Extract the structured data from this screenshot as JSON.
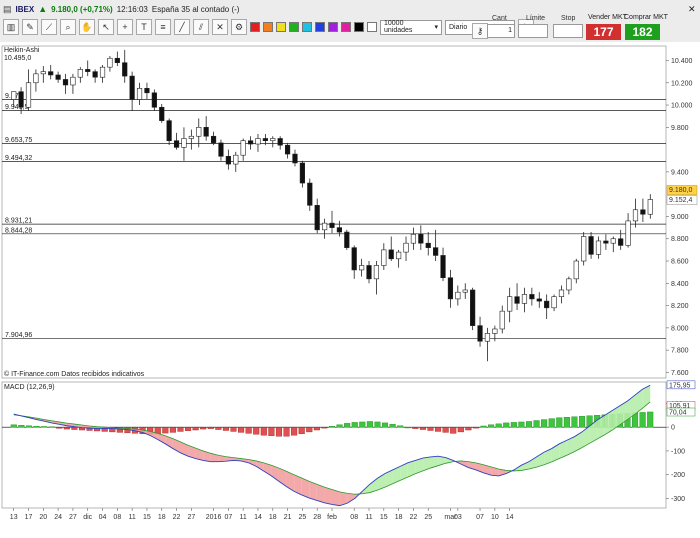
{
  "toolbar": {
    "symbol": "IBEX",
    "price_change": "9.180,0 (+0,71%)",
    "time": "12:16:03",
    "description": "España 35 al contado (-)",
    "units_select": "10000 unidades",
    "period_select": "Diario",
    "cant_label": "Cant",
    "cant_value": "1",
    "limite_label": "Límite",
    "stop_label": "Stop",
    "sell_label": "Vender MKT",
    "sell_value": "177",
    "buy_label": "Comprar MKT",
    "buy_value": "182",
    "sell_color": "#d03030",
    "buy_color": "#1ea01e",
    "icons": [
      "chart-type-icon",
      "pencil-icon",
      "ruler-icon",
      "zoom-icon",
      "hand-icon",
      "cursor-icon"
    ]
  },
  "chart_data": [
    {
      "type": "candlestick",
      "title": "Heikin-Ashi",
      "top_value_label": "10.495,0",
      "current_price_label": "9.180,0",
      "current_price_label2": "9.152,4",
      "footer": "© IT-Finance.com  Datos recibidos indicativos",
      "ylim": [
        7550,
        10530
      ],
      "yticks": [
        {
          "v": 10400,
          "t": "10.400"
        },
        {
          "v": 10200,
          "t": "10.200"
        },
        {
          "v": 10000,
          "t": "10.000"
        },
        {
          "v": 9800,
          "t": "9.800"
        },
        {
          "v": 9400,
          "t": "9.400"
        },
        {
          "v": 9000,
          "t": "9.000"
        },
        {
          "v": 8800,
          "t": "8.800"
        },
        {
          "v": 8600,
          "t": "8.600"
        },
        {
          "v": 8400,
          "t": "8.400"
        },
        {
          "v": 8200,
          "t": "8.200"
        },
        {
          "v": 8000,
          "t": "8.000"
        },
        {
          "v": 7800,
          "t": "7.800"
        },
        {
          "v": 7600,
          "t": "7.600"
        }
      ],
      "hlines": [
        {
          "v": 10050,
          "label": "9.77"
        },
        {
          "v": 9950,
          "label": "9.941,5"
        },
        {
          "v": 9653.75,
          "label": "9.653,75"
        },
        {
          "v": 9494.32,
          "label": "9.494,32"
        },
        {
          "v": 8931.21,
          "label": "8.931,21"
        },
        {
          "v": 8844.28,
          "label": "8.844,28"
        },
        {
          "v": 7904.96,
          "label": "7.904,96"
        }
      ],
      "candles": [
        {
          "o": 10050,
          "h": 10120,
          "l": 9980,
          "c": 10120
        },
        {
          "o": 10120,
          "h": 10160,
          "l": 9920,
          "c": 9980
        },
        {
          "o": 9980,
          "h": 10320,
          "l": 9950,
          "c": 10200
        },
        {
          "o": 10200,
          "h": 10320,
          "l": 10120,
          "c": 10280
        },
        {
          "o": 10280,
          "h": 10350,
          "l": 10200,
          "c": 10300
        },
        {
          "o": 10300,
          "h": 10360,
          "l": 10230,
          "c": 10270
        },
        {
          "o": 10270,
          "h": 10300,
          "l": 10200,
          "c": 10230
        },
        {
          "o": 10230,
          "h": 10280,
          "l": 10100,
          "c": 10180
        },
        {
          "o": 10180,
          "h": 10280,
          "l": 10100,
          "c": 10250
        },
        {
          "o": 10250,
          "h": 10340,
          "l": 10200,
          "c": 10320
        },
        {
          "o": 10320,
          "h": 10400,
          "l": 10260,
          "c": 10300
        },
        {
          "o": 10300,
          "h": 10320,
          "l": 10200,
          "c": 10250
        },
        {
          "o": 10250,
          "h": 10360,
          "l": 10200,
          "c": 10340
        },
        {
          "o": 10340,
          "h": 10440,
          "l": 10300,
          "c": 10420
        },
        {
          "o": 10420,
          "h": 10480,
          "l": 10350,
          "c": 10380
        },
        {
          "o": 10380,
          "h": 10495,
          "l": 10200,
          "c": 10260
        },
        {
          "o": 10260,
          "h": 10300,
          "l": 9950,
          "c": 10050
        },
        {
          "o": 10050,
          "h": 10200,
          "l": 10000,
          "c": 10150
        },
        {
          "o": 10150,
          "h": 10200,
          "l": 10050,
          "c": 10110
        },
        {
          "o": 10110,
          "h": 10140,
          "l": 9950,
          "c": 9980
        },
        {
          "o": 9980,
          "h": 10010,
          "l": 9840,
          "c": 9860
        },
        {
          "o": 9860,
          "h": 9880,
          "l": 9640,
          "c": 9680
        },
        {
          "o": 9680,
          "h": 9750,
          "l": 9600,
          "c": 9620
        },
        {
          "o": 9620,
          "h": 9800,
          "l": 9500,
          "c": 9700
        },
        {
          "o": 9700,
          "h": 9780,
          "l": 9600,
          "c": 9720
        },
        {
          "o": 9720,
          "h": 9880,
          "l": 9620,
          "c": 9800
        },
        {
          "o": 9800,
          "h": 9900,
          "l": 9680,
          "c": 9720
        },
        {
          "o": 9720,
          "h": 9760,
          "l": 9640,
          "c": 9660
        },
        {
          "o": 9660,
          "h": 9690,
          "l": 9500,
          "c": 9540
        },
        {
          "o": 9540,
          "h": 9600,
          "l": 9420,
          "c": 9470
        },
        {
          "o": 9470,
          "h": 9580,
          "l": 9400,
          "c": 9550
        },
        {
          "o": 9550,
          "h": 9700,
          "l": 9500,
          "c": 9680
        },
        {
          "o": 9680,
          "h": 9720,
          "l": 9600,
          "c": 9650
        },
        {
          "o": 9650,
          "h": 9740,
          "l": 9580,
          "c": 9700
        },
        {
          "o": 9700,
          "h": 9740,
          "l": 9640,
          "c": 9680
        },
        {
          "o": 9680,
          "h": 9720,
          "l": 9620,
          "c": 9700
        },
        {
          "o": 9700,
          "h": 9720,
          "l": 9600,
          "c": 9640
        },
        {
          "o": 9640,
          "h": 9660,
          "l": 9520,
          "c": 9560
        },
        {
          "o": 9560,
          "h": 9600,
          "l": 9450,
          "c": 9480
        },
        {
          "o": 9480,
          "h": 9500,
          "l": 9260,
          "c": 9300
        },
        {
          "o": 9300,
          "h": 9340,
          "l": 9050,
          "c": 9100
        },
        {
          "o": 9100,
          "h": 9160,
          "l": 8850,
          "c": 8880
        },
        {
          "o": 8880,
          "h": 8980,
          "l": 8800,
          "c": 8940
        },
        {
          "o": 8940,
          "h": 9050,
          "l": 8850,
          "c": 8900
        },
        {
          "o": 8900,
          "h": 8960,
          "l": 8820,
          "c": 8860
        },
        {
          "o": 8860,
          "h": 8880,
          "l": 8700,
          "c": 8720
        },
        {
          "o": 8720,
          "h": 8740,
          "l": 8440,
          "c": 8520
        },
        {
          "o": 8520,
          "h": 8620,
          "l": 8460,
          "c": 8560
        },
        {
          "o": 8560,
          "h": 8600,
          "l": 8400,
          "c": 8440
        },
        {
          "o": 8440,
          "h": 8600,
          "l": 8300,
          "c": 8560
        },
        {
          "o": 8560,
          "h": 8760,
          "l": 8520,
          "c": 8700
        },
        {
          "o": 8700,
          "h": 8820,
          "l": 8600,
          "c": 8620
        },
        {
          "o": 8620,
          "h": 8700,
          "l": 8540,
          "c": 8680
        },
        {
          "o": 8680,
          "h": 8820,
          "l": 8600,
          "c": 8760
        },
        {
          "o": 8760,
          "h": 8900,
          "l": 8700,
          "c": 8840
        },
        {
          "o": 8840,
          "h": 8920,
          "l": 8700,
          "c": 8760
        },
        {
          "o": 8760,
          "h": 8860,
          "l": 8650,
          "c": 8720
        },
        {
          "o": 8720,
          "h": 8880,
          "l": 8600,
          "c": 8650
        },
        {
          "o": 8650,
          "h": 8720,
          "l": 8420,
          "c": 8450
        },
        {
          "o": 8450,
          "h": 8520,
          "l": 8180,
          "c": 8260
        },
        {
          "o": 8260,
          "h": 8380,
          "l": 8200,
          "c": 8320
        },
        {
          "o": 8320,
          "h": 8400,
          "l": 8260,
          "c": 8340
        },
        {
          "o": 8340,
          "h": 8360,
          "l": 7980,
          "c": 8020
        },
        {
          "o": 8020,
          "h": 8100,
          "l": 7830,
          "c": 7880
        },
        {
          "o": 7880,
          "h": 8000,
          "l": 7700,
          "c": 7950
        },
        {
          "o": 7950,
          "h": 8020,
          "l": 7880,
          "c": 7990
        },
        {
          "o": 7990,
          "h": 8200,
          "l": 7950,
          "c": 8150
        },
        {
          "o": 8150,
          "h": 8360,
          "l": 8050,
          "c": 8280
        },
        {
          "o": 8280,
          "h": 8400,
          "l": 8160,
          "c": 8220
        },
        {
          "o": 8220,
          "h": 8360,
          "l": 8140,
          "c": 8300
        },
        {
          "o": 8300,
          "h": 8360,
          "l": 8200,
          "c": 8260
        },
        {
          "o": 8260,
          "h": 8320,
          "l": 8180,
          "c": 8240
        },
        {
          "o": 8240,
          "h": 8300,
          "l": 8080,
          "c": 8180
        },
        {
          "o": 8180,
          "h": 8300,
          "l": 8150,
          "c": 8280
        },
        {
          "o": 8280,
          "h": 8380,
          "l": 8220,
          "c": 8340
        },
        {
          "o": 8340,
          "h": 8460,
          "l": 8300,
          "c": 8440
        },
        {
          "o": 8440,
          "h": 8620,
          "l": 8400,
          "c": 8600
        },
        {
          "o": 8600,
          "h": 8860,
          "l": 8560,
          "c": 8820
        },
        {
          "o": 8820,
          "h": 8860,
          "l": 8620,
          "c": 8660
        },
        {
          "o": 8660,
          "h": 8820,
          "l": 8620,
          "c": 8780
        },
        {
          "o": 8780,
          "h": 8840,
          "l": 8700,
          "c": 8760
        },
        {
          "o": 8760,
          "h": 8820,
          "l": 8680,
          "c": 8800
        },
        {
          "o": 8800,
          "h": 8880,
          "l": 8700,
          "c": 8740
        },
        {
          "o": 8740,
          "h": 9030,
          "l": 8720,
          "c": 8960
        },
        {
          "o": 8960,
          "h": 9160,
          "l": 8900,
          "c": 9060
        },
        {
          "o": 9060,
          "h": 9160,
          "l": 8950,
          "c": 9020
        },
        {
          "o": 9020,
          "h": 9200,
          "l": 8980,
          "c": 9152
        }
      ],
      "xticks": [
        {
          "i": 0,
          "t": "13"
        },
        {
          "i": 2,
          "t": "17"
        },
        {
          "i": 4,
          "t": "20"
        },
        {
          "i": 6,
          "t": "24"
        },
        {
          "i": 8,
          "t": "27"
        },
        {
          "i": 10,
          "t": "dic"
        },
        {
          "i": 12,
          "t": "04"
        },
        {
          "i": 14,
          "t": "08"
        },
        {
          "i": 16,
          "t": "11"
        },
        {
          "i": 18,
          "t": "15"
        },
        {
          "i": 20,
          "t": "18"
        },
        {
          "i": 22,
          "t": "22"
        },
        {
          "i": 24,
          "t": "27"
        },
        {
          "i": 27,
          "t": "2016"
        },
        {
          "i": 29,
          "t": "07"
        },
        {
          "i": 31,
          "t": "11"
        },
        {
          "i": 33,
          "t": "14"
        },
        {
          "i": 35,
          "t": "18"
        },
        {
          "i": 37,
          "t": "21"
        },
        {
          "i": 39,
          "t": "25"
        },
        {
          "i": 41,
          "t": "28"
        },
        {
          "i": 43,
          "t": "feb"
        },
        {
          "i": 46,
          "t": "08"
        },
        {
          "i": 48,
          "t": "11"
        },
        {
          "i": 50,
          "t": "15"
        },
        {
          "i": 52,
          "t": "18"
        },
        {
          "i": 54,
          "t": "22"
        },
        {
          "i": 56,
          "t": "25"
        },
        {
          "i": 59,
          "t": "mar"
        },
        {
          "i": 60,
          "t": "03"
        },
        {
          "i": 63,
          "t": "07"
        },
        {
          "i": 65,
          "t": "10"
        },
        {
          "i": 67,
          "t": "14"
        }
      ]
    },
    {
      "type": "macd",
      "title": "MACD (12,26,9)",
      "ylim": [
        -340,
        190
      ],
      "yticks": [
        {
          "v": 100,
          "t": "100"
        },
        {
          "v": 0,
          "t": "0"
        },
        {
          "v": -100,
          "t": "-100"
        },
        {
          "v": -200,
          "t": "-200"
        },
        {
          "v": -300,
          "t": "-300"
        }
      ],
      "value_labels": [
        {
          "v": 175.95,
          "t": "175,95"
        },
        {
          "v": 105.91,
          "t": "105,91"
        },
        {
          "v": 70.04,
          "t": "70,04"
        }
      ],
      "macd": [
        55,
        47,
        40,
        32,
        25,
        18,
        12,
        6,
        2,
        -2,
        -4,
        -6,
        -5,
        -6,
        -8,
        -10,
        -15,
        -22,
        -35,
        -52,
        -70,
        -90,
        -108,
        -122,
        -132,
        -140,
        -145,
        -145,
        -143,
        -140,
        -142,
        -150,
        -165,
        -185,
        -205,
        -228,
        -250,
        -270,
        -285,
        -298,
        -308,
        -318,
        -325,
        -330,
        -320,
        -300,
        -270,
        -240,
        -215,
        -195,
        -180,
        -165,
        -150,
        -140,
        -130,
        -125,
        -122,
        -128,
        -140,
        -155,
        -170,
        -180,
        -192,
        -202,
        -205,
        -195,
        -180,
        -160,
        -145,
        -125,
        -105,
        -90,
        -70,
        -55,
        -40,
        -20,
        5,
        30,
        50,
        70,
        90,
        110,
        135,
        160,
        176
      ],
      "signal": [
        52,
        48,
        43,
        38,
        32,
        27,
        22,
        17,
        13,
        9,
        5,
        2,
        0,
        -2,
        -4,
        -6,
        -8,
        -12,
        -18,
        -26,
        -36,
        -48,
        -62,
        -76,
        -88,
        -100,
        -110,
        -118,
        -124,
        -128,
        -132,
        -136,
        -142,
        -150,
        -160,
        -172,
        -186,
        -200,
        -214,
        -228,
        -240,
        -252,
        -262,
        -272,
        -278,
        -282,
        -280,
        -275,
        -265,
        -252,
        -238,
        -224,
        -210,
        -196,
        -184,
        -172,
        -162,
        -152,
        -145,
        -142,
        -145,
        -150,
        -158,
        -167,
        -176,
        -182,
        -184,
        -182,
        -176,
        -168,
        -158,
        -146,
        -132,
        -118,
        -103,
        -86,
        -68,
        -50,
        -32,
        -12,
        10,
        32,
        55,
        80,
        106
      ],
      "histogram": [
        10,
        8,
        6,
        4,
        3,
        2,
        -5,
        -8,
        -10,
        -12,
        -14,
        -16,
        -18,
        -20,
        -22,
        -24,
        -26,
        -28,
        -30,
        -28,
        -25,
        -22,
        -18,
        -15,
        -12,
        -8,
        -6,
        -10,
        -14,
        -18,
        -22,
        -26,
        -30,
        -34,
        -36,
        -38,
        -38,
        -34,
        -28,
        -20,
        -12,
        -4,
        4,
        10,
        16,
        20,
        22,
        24,
        22,
        18,
        12,
        6,
        0,
        -6,
        -10,
        -14,
        -18,
        -22,
        -26,
        -20,
        -12,
        -4,
        5,
        10,
        14,
        18,
        20,
        22,
        24,
        28,
        32,
        36,
        40,
        42,
        44,
        46,
        48,
        50,
        52,
        54,
        56,
        58,
        60,
        62,
        64
      ]
    }
  ]
}
